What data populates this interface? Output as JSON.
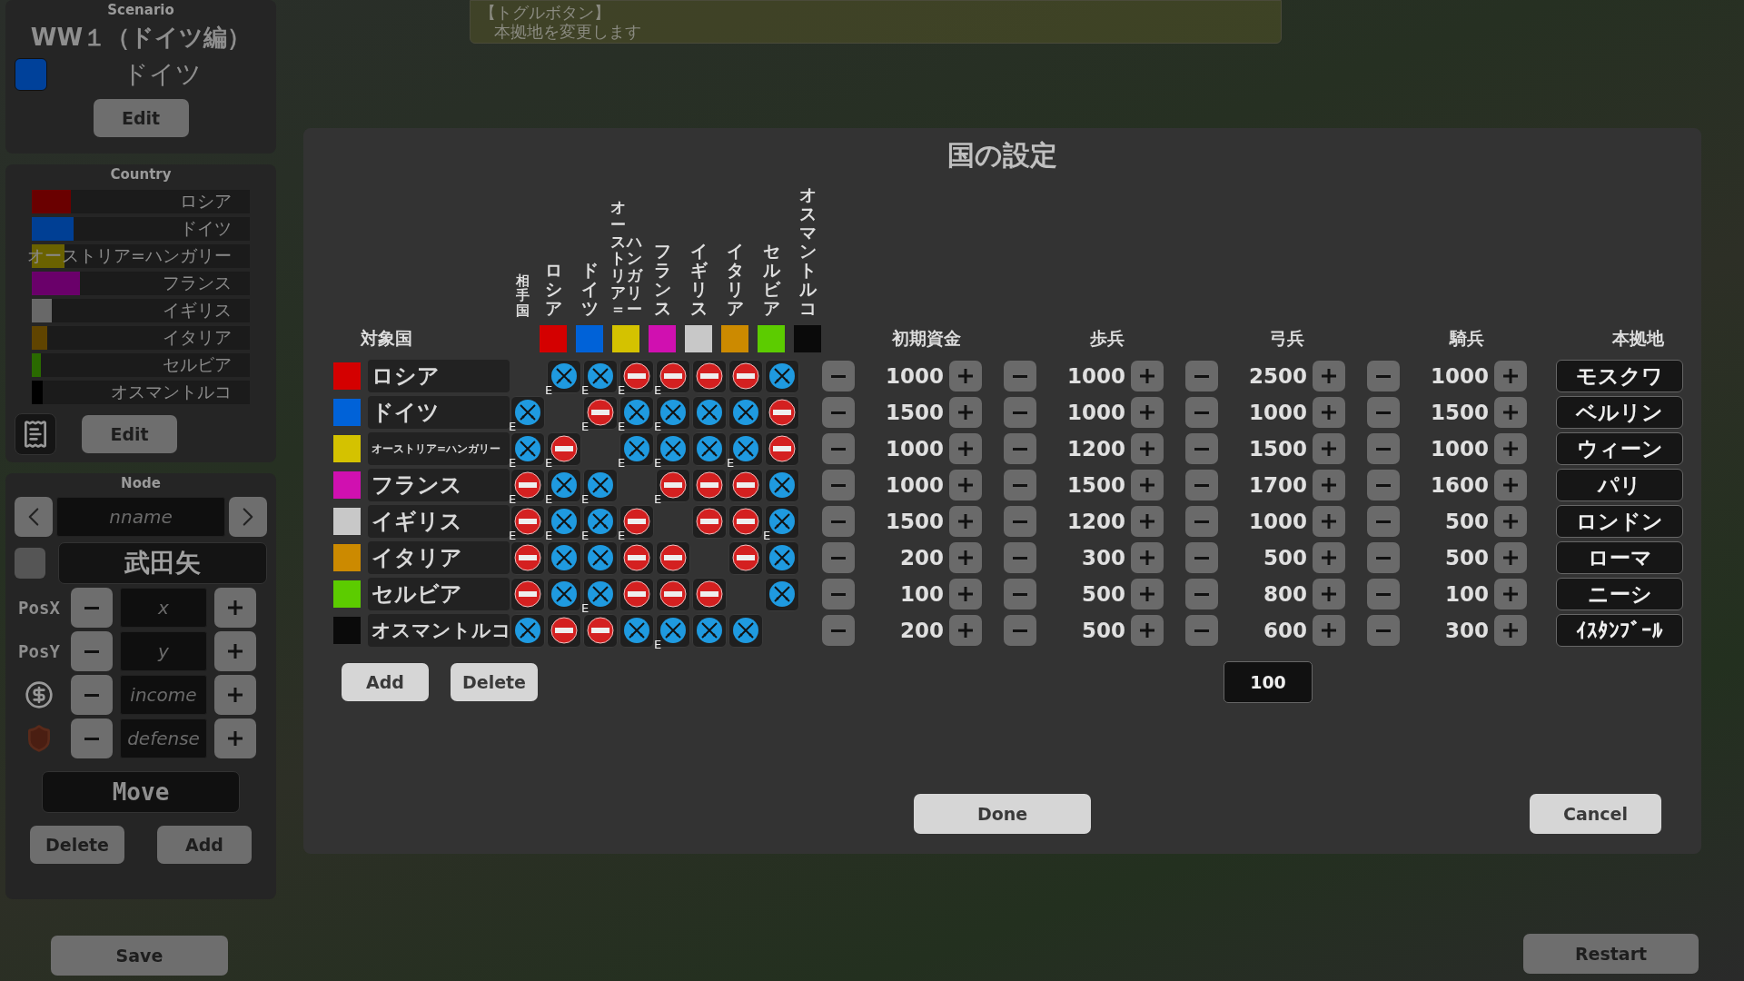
{
  "tooltip": {
    "title": "【トグルボタン】",
    "text": "本拠地を変更します"
  },
  "scenario": {
    "heading": "Scenario",
    "name": "WW１（ドイツ編）",
    "player": {
      "name": "ドイツ",
      "color": "#00419a"
    },
    "edit": "Edit"
  },
  "country_panel": {
    "heading": "Country",
    "countries": [
      {
        "name": "ロシア",
        "color": "#6a0000",
        "level": 0.18
      },
      {
        "name": "ドイツ",
        "color": "#003f94",
        "level": 0.19
      },
      {
        "name": "オーストリア=ハンガリー",
        "color": "#6a6200",
        "level": 0.15
      },
      {
        "name": "フランス",
        "color": "#6a006a",
        "level": 0.22
      },
      {
        "name": "イギリス",
        "color": "#686868",
        "level": 0.09
      },
      {
        "name": "イタリア",
        "color": "#604400",
        "level": 0.07
      },
      {
        "name": "セルビア",
        "color": "#2a6a00",
        "level": 0.04
      },
      {
        "name": "オスマントルコ",
        "color": "#000000",
        "level": 0.05
      }
    ],
    "edit": "Edit"
  },
  "node_panel": {
    "heading": "Node",
    "name_placeholder": "nname",
    "selected_name": "武田矢",
    "fields": [
      {
        "kind": "label",
        "label": "PosX",
        "placeholder": "x"
      },
      {
        "kind": "label",
        "label": "PosY",
        "placeholder": "y"
      },
      {
        "kind": "income",
        "placeholder": "income"
      },
      {
        "kind": "defense",
        "placeholder": "defense"
      }
    ],
    "move": "Move",
    "delete": "Delete",
    "add": "Add"
  },
  "save": "Save",
  "restart": "Restart",
  "dialog": {
    "title": "国の設定",
    "opponent_label": "相手国",
    "target_label": "対象国",
    "opponent_columns": [
      {
        "lines": [
          "ロシア"
        ],
        "color": "#d40000"
      },
      {
        "lines": [
          "ドイツ"
        ],
        "color": "#0062d8"
      },
      {
        "lines": [
          "オーストリア＝",
          "ハンガリー"
        ],
        "color": "#d4c200"
      },
      {
        "lines": [
          "フランス"
        ],
        "color": "#d010b0"
      },
      {
        "lines": [
          "イギリス"
        ],
        "color": "#c8c8c8"
      },
      {
        "lines": [
          "イタリア"
        ],
        "color": "#cc8a00"
      },
      {
        "lines": [
          "セルビア"
        ],
        "color": "#5ccc00"
      },
      {
        "lines": [
          "オスマントルコ"
        ],
        "color": "#0a0a0a"
      }
    ],
    "stat_columns": [
      "初期資金",
      "歩兵",
      "弓兵",
      "騎兵"
    ],
    "base_column": "本拠地",
    "rows": [
      {
        "name": "ロシア",
        "color": "#d40000",
        "relations": [
          {
            "kind": "self"
          },
          {
            "kind": "war",
            "tag": "E"
          },
          {
            "kind": "war",
            "tag": "E"
          },
          {
            "kind": "peace",
            "tag": "E"
          },
          {
            "kind": "peace",
            "tag": "E"
          },
          {
            "kind": "peace"
          },
          {
            "kind": "peace"
          },
          {
            "kind": "war"
          }
        ],
        "stats": [
          "1000",
          "1000",
          "2500",
          "1000"
        ],
        "base": "モスクワ"
      },
      {
        "name": "ドイツ",
        "color": "#0062d8",
        "relations": [
          {
            "kind": "war",
            "tag": "E"
          },
          {
            "kind": "self"
          },
          {
            "kind": "peace",
            "tag": "E"
          },
          {
            "kind": "war",
            "tag": "E"
          },
          {
            "kind": "war",
            "tag": "E"
          },
          {
            "kind": "war"
          },
          {
            "kind": "war"
          },
          {
            "kind": "peace"
          }
        ],
        "stats": [
          "1500",
          "1000",
          "1000",
          "1500"
        ],
        "base": "ベルリン"
      },
      {
        "name": "オーストリア=ハンガリー",
        "color": "#d4c200",
        "relations": [
          {
            "kind": "war",
            "tag": "E"
          },
          {
            "kind": "peace",
            "tag": "E"
          },
          {
            "kind": "self"
          },
          {
            "kind": "war",
            "tag": "E"
          },
          {
            "kind": "war",
            "tag": "E"
          },
          {
            "kind": "war"
          },
          {
            "kind": "war",
            "tag": "E"
          },
          {
            "kind": "peace"
          }
        ],
        "stats": [
          "1000",
          "1200",
          "1500",
          "1000"
        ],
        "base": "ウィーン"
      },
      {
        "name": "フランス",
        "color": "#d010b0",
        "relations": [
          {
            "kind": "peace",
            "tag": "E"
          },
          {
            "kind": "war",
            "tag": "E"
          },
          {
            "kind": "war",
            "tag": "E"
          },
          {
            "kind": "self"
          },
          {
            "kind": "peace",
            "tag": "E"
          },
          {
            "kind": "peace"
          },
          {
            "kind": "peace"
          },
          {
            "kind": "war"
          }
        ],
        "stats": [
          "1000",
          "1500",
          "1700",
          "1600"
        ],
        "base": "パリ"
      },
      {
        "name": "イギリス",
        "color": "#c8c8c8",
        "relations": [
          {
            "kind": "peace",
            "tag": "E"
          },
          {
            "kind": "war",
            "tag": "E"
          },
          {
            "kind": "war",
            "tag": "E"
          },
          {
            "kind": "peace",
            "tag": "E"
          },
          {
            "kind": "self"
          },
          {
            "kind": "peace"
          },
          {
            "kind": "peace"
          },
          {
            "kind": "war",
            "tag": "E"
          }
        ],
        "stats": [
          "1500",
          "1200",
          "1000",
          "500"
        ],
        "base": "ロンドン"
      },
      {
        "name": "イタリア",
        "color": "#cc8a00",
        "relations": [
          {
            "kind": "peace"
          },
          {
            "kind": "war"
          },
          {
            "kind": "war"
          },
          {
            "kind": "peace"
          },
          {
            "kind": "peace"
          },
          {
            "kind": "self"
          },
          {
            "kind": "peace"
          },
          {
            "kind": "war"
          }
        ],
        "stats": [
          "200",
          "300",
          "500",
          "500"
        ],
        "base": "ローマ"
      },
      {
        "name": "セルビア",
        "color": "#5ccc00",
        "relations": [
          {
            "kind": "peace"
          },
          {
            "kind": "war"
          },
          {
            "kind": "war",
            "tag": "E"
          },
          {
            "kind": "peace"
          },
          {
            "kind": "peace"
          },
          {
            "kind": "peace"
          },
          {
            "kind": "self"
          },
          {
            "kind": "war"
          }
        ],
        "stats": [
          "100",
          "500",
          "800",
          "100"
        ],
        "base": "ニーシ"
      },
      {
        "name": "オスマントルコ",
        "color": "#0a0a0a",
        "relations": [
          {
            "kind": "war"
          },
          {
            "kind": "peace"
          },
          {
            "kind": "peace"
          },
          {
            "kind": "war"
          },
          {
            "kind": "war",
            "tag": "E"
          },
          {
            "kind": "war"
          },
          {
            "kind": "war"
          },
          {
            "kind": "self"
          }
        ],
        "stats": [
          "200",
          "500",
          "600",
          "300"
        ],
        "base": "ｲｽﾀﾝﾌﾞｰﾙ"
      }
    ],
    "add": "Add",
    "delete": "Delete",
    "amount": "100",
    "done": "Done",
    "cancel": "Cancel"
  }
}
